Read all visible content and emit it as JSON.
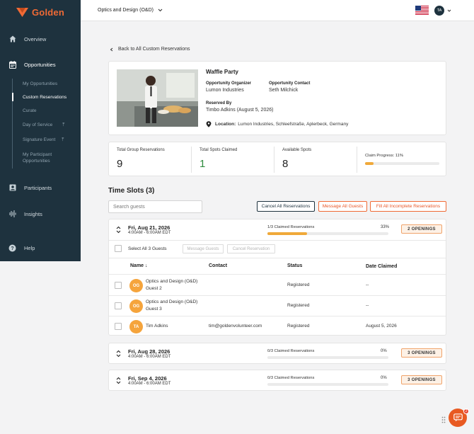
{
  "brand": {
    "name": "Golden",
    "color": "#f06a35"
  },
  "sidebar": {
    "items": [
      {
        "label": "Overview",
        "icon": "home-icon"
      },
      {
        "label": "Opportunities",
        "icon": "calendar-icon"
      },
      {
        "label": "Participants",
        "icon": "person-badge-icon"
      },
      {
        "label": "Insights",
        "icon": "waveform-icon"
      },
      {
        "label": "Help",
        "icon": "help-icon"
      }
    ],
    "subitems": [
      {
        "label": "My Opportunities"
      },
      {
        "label": "Custom Reservations"
      },
      {
        "label": "Curate"
      },
      {
        "label": "Day of Service"
      },
      {
        "label": "Signature Event"
      },
      {
        "label": "My Participant",
        "label2": "Opportunities"
      }
    ]
  },
  "topbar": {
    "org": "Optics and Design (O&D)",
    "avatar": "TA"
  },
  "back_link": "Back to All Custom Reservations",
  "opportunity": {
    "title": "Waffle Party",
    "organizer_label": "Opportunity Organizer",
    "organizer": "Lumon Industries",
    "contact_label": "Opportunity Contact",
    "contact": "Seth Milchick",
    "reserved_by_label": "Reserved By",
    "reserved_by": "Timbo Adkins (August 5, 2026)",
    "location_label": "Location:",
    "location": "Lumon Industries, Schleefstraße, Aplerbeck, Germany"
  },
  "stats": {
    "total_group_label": "Total Group Reservations",
    "total_group": "9",
    "total_claimed_label": "Total Spots Claimed",
    "total_claimed": "1",
    "available_label": "Available Spots",
    "available": "8",
    "progress_label": "Claim Progress: 11%",
    "progress": 0.11
  },
  "timeslots": {
    "title": "Time Slots (3)",
    "search_placeholder": "Search guests",
    "cancel_all": "Cancel All Reservations",
    "message_all": "Message All Guests",
    "fill_all": "Fill All Incomplete Reservations",
    "select_all": "Select All 3 Guests",
    "message_guests": "Message Guests",
    "cancel_reservation": "Cancel Reservation",
    "headers": {
      "name": "Name ↓",
      "contact": "Contact",
      "status": "Status",
      "date": "Date Claimed"
    },
    "slots": [
      {
        "date": "Fri, Aug 21, 2026",
        "time": "4:00AM - 6:00AM EDT",
        "claimed": "1/3 Claimed Reservations",
        "pct": "33%",
        "fill": 0.33,
        "openings": "2 OPENINGS"
      },
      {
        "date": "Fri, Aug 28, 2026",
        "time": "4:00AM - 6:00AM EDT",
        "claimed": "0/3 Claimed Reservations",
        "pct": "0%",
        "fill": 0,
        "openings": "3 OPENINGS"
      },
      {
        "date": "Fri, Sep 4, 2026",
        "time": "4:00AM - 6:00AM EDT",
        "claimed": "0/3 Claimed Reservations",
        "pct": "0%",
        "fill": 0,
        "openings": "3 OPENINGS"
      }
    ],
    "guests": [
      {
        "initials": "OG",
        "name": "Optics and Design (O&D)",
        "name2": "Guest 2",
        "contact": "",
        "status": "Registered",
        "date": "--"
      },
      {
        "initials": "OG",
        "name": "Optics and Design (O&D)",
        "name2": "Guest 3",
        "contact": "",
        "status": "Registered",
        "date": "--"
      },
      {
        "initials": "TA",
        "name": "Tim Adkins",
        "name2": "",
        "contact": "tim@goldenvolunteer.com",
        "status": "Registered",
        "date": "August 5, 2026"
      }
    ]
  },
  "chat": {
    "badge": "2"
  },
  "colors": {
    "sidebar": "#1e323e",
    "accent": "#f06a35",
    "progress": "#f0a93a",
    "avatar": "#f5a43c"
  }
}
